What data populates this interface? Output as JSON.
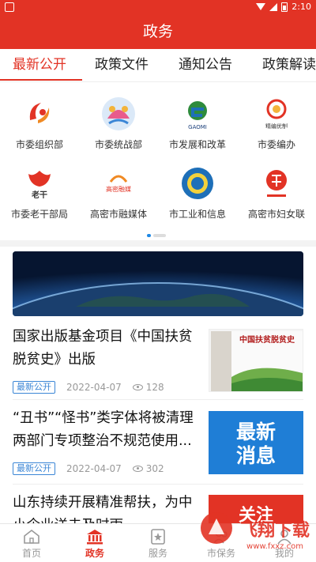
{
  "status": {
    "time": "2:10"
  },
  "header": {
    "title": "政务"
  },
  "tabs": [
    {
      "label": "最新公开",
      "active": true
    },
    {
      "label": "政策文件"
    },
    {
      "label": "通知公告"
    },
    {
      "label": "政策解读"
    }
  ],
  "grid": [
    {
      "label": "市委组织部",
      "icon": "party-emblem-icon"
    },
    {
      "label": "市委统战部",
      "icon": "united-front-logo-icon"
    },
    {
      "label": "市发展和改革",
      "icon": "gaomi-development-logo-icon",
      "logo_text": "GAOMI"
    },
    {
      "label": "市委编办",
      "icon": "staffing-office-logo-icon",
      "logo_text": "精编优制"
    },
    {
      "label": "市委老干部局",
      "icon": "veteran-cadres-logo-icon",
      "logo_text": "老干"
    },
    {
      "label": "高密市融媒体",
      "icon": "media-center-logo-icon",
      "logo_text": "高密融媒"
    },
    {
      "label": "市工业和信息",
      "icon": "industry-info-logo-icon"
    },
    {
      "label": "高密市妇女联",
      "icon": "womens-federation-logo-icon"
    }
  ],
  "news": [
    {
      "title": "国家出版基金项目《中国扶贫脱贫史》出版",
      "tag": "最新公开",
      "date": "2022-04-07",
      "views": "128",
      "thumb_text": "中国扶贫脱贫史"
    },
    {
      "title": "“丑书”“怪书”类字体将被清理 两部门专项整治不规范使用...",
      "tag": "最新公开",
      "date": "2022-04-07",
      "views": "302",
      "thumb_text": "最新\n消息"
    },
    {
      "title": "山东持续开展精准帮扶，为中小企业送去及时雨",
      "thumb_text": "关注"
    }
  ],
  "bottom_nav": [
    {
      "label": "首页",
      "icon": "home-icon"
    },
    {
      "label": "政务",
      "icon": "government-building-icon",
      "active": true
    },
    {
      "label": "服务",
      "icon": "service-badge-icon"
    },
    {
      "label": "市保务",
      "icon": "people-icon"
    },
    {
      "label": "我的",
      "icon": "user-icon"
    }
  ],
  "watermark": {
    "text": "飞翔下载",
    "url": "www.fxxz.com"
  },
  "colors": {
    "brand": "#e23325",
    "tag": "#3b86d6",
    "indicator": "#1e88e5"
  }
}
